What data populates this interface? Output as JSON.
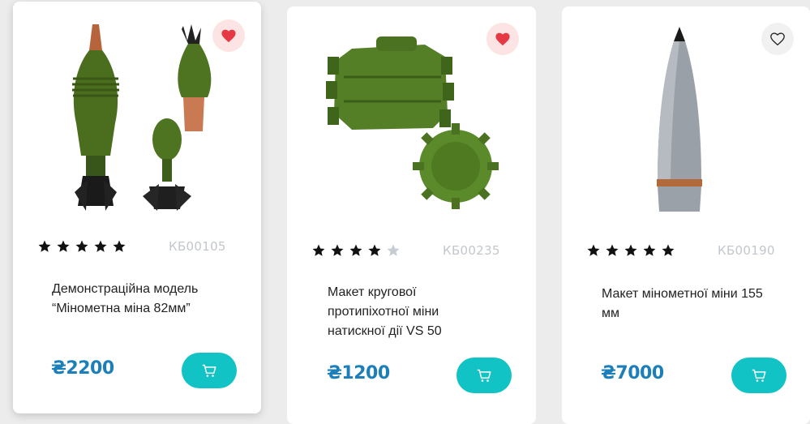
{
  "products": [
    {
      "title": "Демонстраційна модель “Мінометна міна 82мм”",
      "sku": "КБ00105",
      "price": "₴2200",
      "rating": 5,
      "favorite": true,
      "image": "mortar-mines-82mm"
    },
    {
      "title": "Макет кругової протипіхотної міни натискної дії VS 50",
      "sku": "КБ00235",
      "price": "₴1200",
      "rating": 4,
      "favorite": true,
      "image": "vs50-mines"
    },
    {
      "title": "Макет мінометної міни 155 мм",
      "sku": "КБ00190",
      "price": "₴7000",
      "rating": 5,
      "favorite": false,
      "image": "shell-155mm"
    }
  ],
  "colors": {
    "price": "#1c7fba",
    "cart_button": "#12c3c5",
    "heart_active": "#e63946",
    "star_filled": "#111111",
    "star_empty": "#c5ccd3"
  },
  "icons": {
    "favorite": "heart-icon",
    "cart": "cart-icon",
    "rating": "star-icon"
  }
}
